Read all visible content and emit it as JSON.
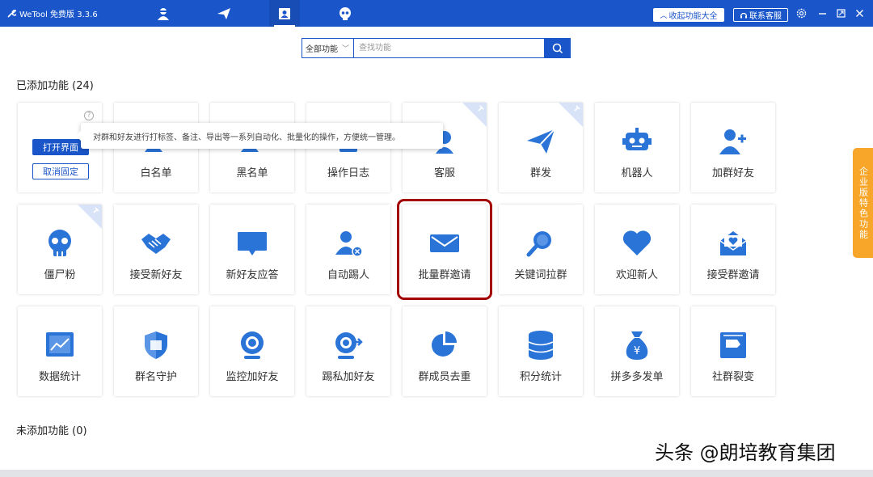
{
  "app": {
    "title": "WeTool 免费版 3.3.6"
  },
  "titlebar": {
    "nav_icons": [
      "user-icon",
      "send-icon",
      "contact-card-icon",
      "skull-icon"
    ],
    "collapse_button": "收起功能大全",
    "support_button": "联系客服"
  },
  "search": {
    "select_value": "全部功能",
    "placeholder": "查找功能"
  },
  "sections": {
    "added_title": "已添加功能 (24)",
    "not_added_title": "未添加功能 (0)"
  },
  "first_card": {
    "open_label": "打开界面",
    "unpin_label": "取消固定",
    "help_glyph": "?",
    "tooltip": "对群和好友进行打标签、备注、导出等一系列自动化、批量化的操作，方便统一管理。"
  },
  "features": [
    {
      "label": "",
      "icon": "tag-icon"
    },
    {
      "label": "白名单",
      "icon": "whitelist-icon"
    },
    {
      "label": "黑名单",
      "icon": "blacklist-icon"
    },
    {
      "label": "操作日志",
      "icon": "log-icon"
    },
    {
      "label": "客服",
      "icon": "customer-service-icon",
      "pinned": true
    },
    {
      "label": "群发",
      "icon": "paper-plane-icon",
      "pinned": true
    },
    {
      "label": "机器人",
      "icon": "robot-icon"
    },
    {
      "label": "加群好友",
      "icon": "add-user-icon"
    },
    {
      "label": "僵尸粉",
      "icon": "skull-icon",
      "pinned": true
    },
    {
      "label": "接受新好友",
      "icon": "handshake-icon"
    },
    {
      "label": "新好友应答",
      "icon": "chat-bubble-icon"
    },
    {
      "label": "自动踢人",
      "icon": "remove-user-icon"
    },
    {
      "label": "批量群邀请",
      "icon": "envelope-icon"
    },
    {
      "label": "关键词拉群",
      "icon": "magnifier-icon"
    },
    {
      "label": "欢迎新人",
      "icon": "heart-icon"
    },
    {
      "label": "接受群邀请",
      "icon": "heart-envelope-icon"
    },
    {
      "label": "数据统计",
      "icon": "line-chart-icon"
    },
    {
      "label": "群名守护",
      "icon": "shield-icon"
    },
    {
      "label": "监控加好友",
      "icon": "webcam-icon"
    },
    {
      "label": "踢私加好友",
      "icon": "kick-icon"
    },
    {
      "label": "群成员去重",
      "icon": "pie-chart-icon"
    },
    {
      "label": "积分统计",
      "icon": "database-icon"
    },
    {
      "label": "拼多多发单",
      "icon": "money-bag-icon"
    },
    {
      "label": "社群裂变",
      "icon": "split-icon"
    }
  ],
  "side_tab": {
    "label": "企业版特色功能"
  },
  "watermark": {
    "text": "头条 @朗培教育集团"
  },
  "colors": {
    "brand": "#1a56c9",
    "icon_blue": "#2a74d8",
    "highlight_border": "#a30000",
    "side_tab": "#f7a62a"
  }
}
